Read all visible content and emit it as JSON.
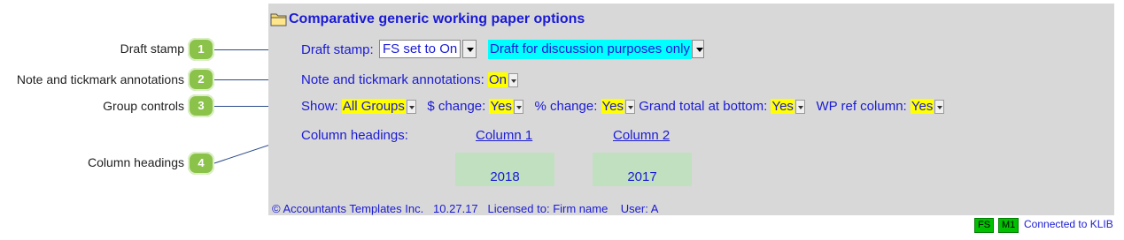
{
  "title": "Comparative generic working paper options",
  "callouts": [
    {
      "label": "Draft stamp",
      "num": "1"
    },
    {
      "label": "Note and tickmark annotations",
      "num": "2"
    },
    {
      "label": "Group controls",
      "num": "3"
    },
    {
      "label": "Column headings",
      "num": "4"
    }
  ],
  "draft": {
    "label": "Draft stamp:",
    "select_value": "FS set to On",
    "text_value": "Draft for discussion purposes only"
  },
  "notes": {
    "label": "Note and tickmark annotations:",
    "value": "On"
  },
  "group": {
    "show_label": "Show:",
    "show_value": "All Groups",
    "dollar_label": "$ change:",
    "dollar_value": "Yes",
    "pct_label": "% change:",
    "pct_value": "Yes",
    "grand_label": "Grand total at bottom:",
    "grand_value": "Yes",
    "wp_label": "WP ref column:",
    "wp_value": "Yes"
  },
  "columns": {
    "label": "Column headings:",
    "col1": "Column 1",
    "col1_year": "2018",
    "col2": "Column 2",
    "col2_year": "2017"
  },
  "footer": "© Accountants Templates Inc.   10.27.17   Licensed to: Firm name    User: A",
  "status": {
    "fs": "FS",
    "m1": "M1",
    "connected": "Connected to KLIB"
  }
}
